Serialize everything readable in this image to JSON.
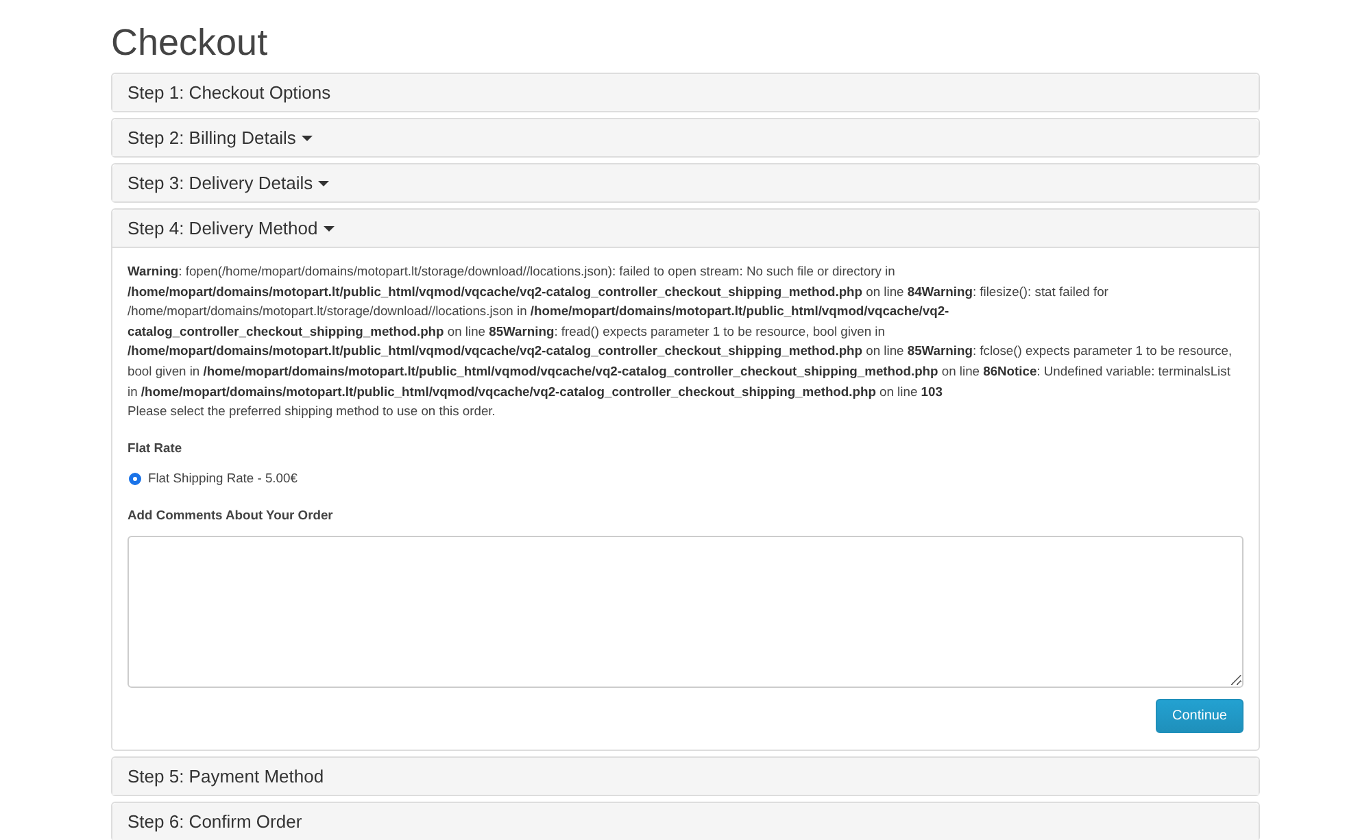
{
  "title": "Checkout",
  "steps": [
    {
      "label": "Step 1: Checkout Options",
      "dropdown": false,
      "expanded": false
    },
    {
      "label": "Step 2: Billing Details",
      "dropdown": true,
      "expanded": false
    },
    {
      "label": "Step 3: Delivery Details",
      "dropdown": true,
      "expanded": false
    },
    {
      "label": "Step 4: Delivery Method",
      "dropdown": true,
      "expanded": true
    },
    {
      "label": "Step 5: Payment Method",
      "dropdown": false,
      "expanded": false
    },
    {
      "label": "Step 6: Confirm Order",
      "dropdown": false,
      "expanded": false
    }
  ],
  "delivery": {
    "error_message": "**Warning**: fopen(/home/mopart/domains/motopart.lt/storage/download//locations.json): failed to open stream: No such file or directory in **/home/mopart/domains/motopart.lt/public_html/vqmod/vqcache/vq2-catalog_controller_checkout_shipping_method.php** on line **84Warning**: filesize(): stat failed for /home/mopart/domains/motopart.lt/storage/download//locations.json in **/home/mopart/domains/motopart.lt/public_html/vqmod/vqcache/vq2-catalog_controller_checkout_shipping_method.php** on line **85Warning**: fread() expects parameter 1 to be resource, bool given in **/home/mopart/domains/motopart.lt/public_html/vqmod/vqcache/vq2-catalog_controller_checkout_shipping_method.php** on line **85Warning**: fclose() expects parameter 1 to be resource, bool given in **/home/mopart/domains/motopart.lt/public_html/vqmod/vqcache/vq2-catalog_controller_checkout_shipping_method.php** on line **86Notice**: Undefined variable: terminalsList in **/home/mopart/domains/motopart.lt/public_html/vqmod/vqcache/vq2-catalog_controller_checkout_shipping_method.php** on line **103**",
    "instruction": "Please select the preferred shipping method to use on this order.",
    "method_title": "Flat Rate",
    "options": [
      {
        "label": "Flat Shipping Rate - 5.00€",
        "selected": true
      }
    ],
    "comments_label": "Add Comments About Your Order",
    "continue_button": "Continue"
  }
}
